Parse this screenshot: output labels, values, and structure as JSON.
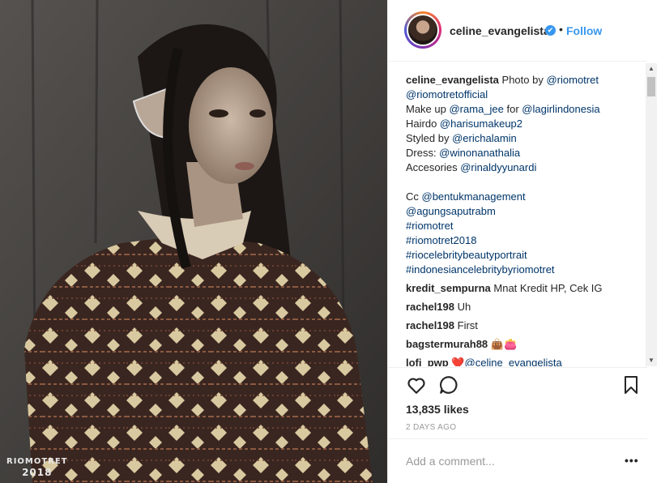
{
  "photo": {
    "alt_colors": {
      "background": "#3c3a38",
      "sweater": "#3a2620",
      "pattern": "#e0cfa2"
    },
    "watermark_line1": "RIOMOTRET",
    "watermark_line2": "2018"
  },
  "header": {
    "username": "celine_evangelista",
    "verified_icon": "✔",
    "separator": "•",
    "follow_label": "Follow"
  },
  "caption": {
    "username": "celine_evangelista",
    "lines": [
      [
        "",
        "Photo by ",
        "@riomotret"
      ],
      [
        "@riomotretofficial"
      ],
      [
        "Make up ",
        "@rama_jee",
        " for ",
        "@lagirlindonesia"
      ],
      [
        "Hairdo ",
        "@harisumakeup2"
      ],
      [
        "Styled by ",
        "@erichalamin"
      ],
      [
        "Dress: ",
        "@winonanathalia"
      ],
      [
        "Accesories ",
        "@rinaldyyunardi"
      ]
    ],
    "cc": "Cc ",
    "cc_mention": "@bentukmanagement",
    "tags": [
      "@agungsaputrabm",
      "#riomotret",
      "#riomotret2018",
      "#riocelebritybeautyportrait",
      "#indonesiancelebritybyriomotret"
    ]
  },
  "comments": [
    {
      "user": "kredit_sempurna",
      "text": "Mnat Kredit HP, Cek IG"
    },
    {
      "user": "rachel198",
      "text": "Uh"
    },
    {
      "user": "rachel198",
      "text": "First"
    },
    {
      "user": "bagstermurah88",
      "text": "👜👛"
    },
    {
      "user": "lofi_pwp",
      "text": "❤️@celine_evangelista"
    }
  ],
  "actions": {
    "like_icon": "heart-icon",
    "comment_icon": "comment-icon",
    "save_icon": "bookmark-icon"
  },
  "likes": "13,835 likes",
  "time": "2 DAYS AGO",
  "add_comment_placeholder": "Add a comment...",
  "more_label": "•••"
}
